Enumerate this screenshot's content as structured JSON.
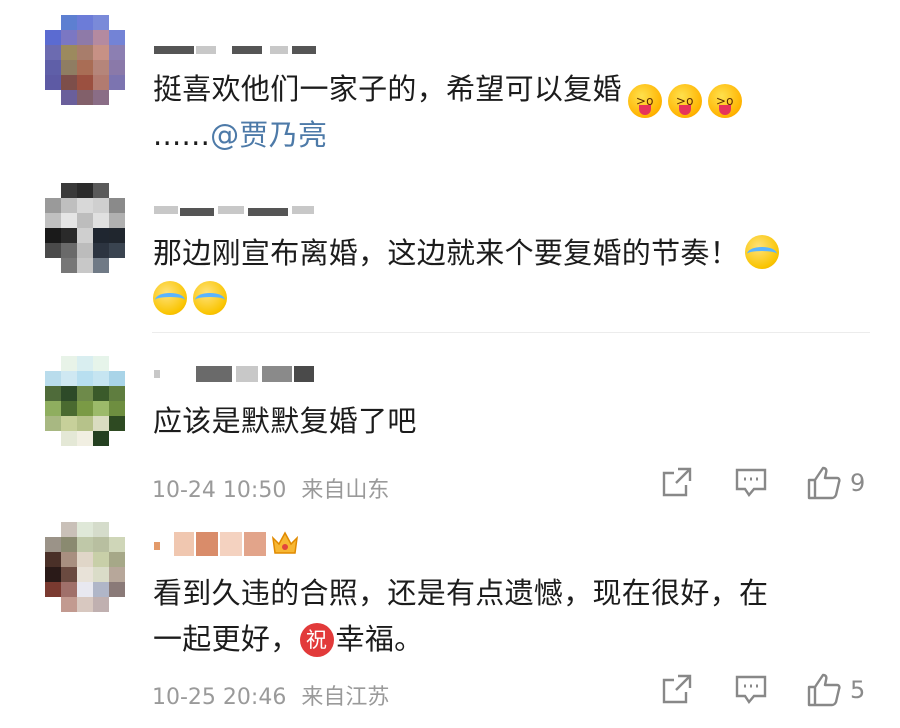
{
  "comments": [
    {
      "lines": [
        "挺喜欢他们一家子的，希望可以复婚",
        "......"
      ],
      "mention": "@贾乃亮",
      "emoji_count": 3
    },
    {
      "lines": [
        "那边刚宣布离婚，这边就来个要复婚的节奏！",
        ""
      ],
      "emoji_count": 3
    },
    {
      "lines": [
        "应该是默默复婚了吧"
      ],
      "date": "10-24 10:50",
      "source": "来自山东",
      "likes": "9"
    },
    {
      "lines": [
        "看到久违的合照，还是有点遗憾，现在很好，在",
        "一起更好，",
        "幸福。"
      ],
      "badge": "祝",
      "date": "10-25 20:46",
      "source": "来自江苏",
      "likes": "5"
    }
  ],
  "icons": {
    "share": "share-icon",
    "comment": "comment-icon",
    "like": "thumbs-up-icon",
    "emoji_1": "tongue-out-emoji",
    "emoji_2": "laugh-cry-emoji",
    "vip": "crown-icon"
  },
  "colors": {
    "mention": "#4d7aa8",
    "meta": "#9a9a9a",
    "badge": "#e23a3a"
  }
}
